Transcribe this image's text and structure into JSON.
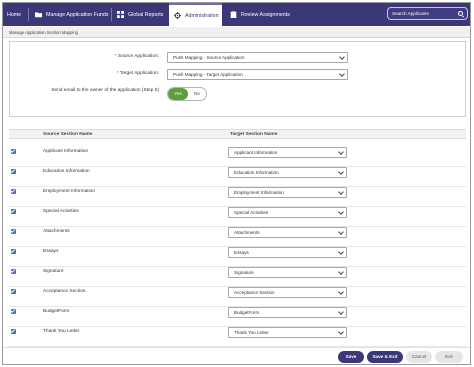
{
  "nav": {
    "home": "Home",
    "items": [
      {
        "label": "Manage Application Funds",
        "icon": "folder-icon"
      },
      {
        "label": "Global Reports",
        "icon": "grid-icon"
      },
      {
        "label": "Administration",
        "icon": "gear-icon"
      },
      {
        "label": "Review Assignments",
        "icon": "clipboard-icon"
      }
    ],
    "active": "Administration",
    "search_placeholder": "Search Applicants"
  },
  "breadcrumb": "Manage Application Section Mapping",
  "form": {
    "source_label": "Source Application:",
    "source_value": "Push Mapping - Source Application",
    "target_label": "Target Application:",
    "target_value": "Push Mapping - Target Application",
    "email_label": "Send email to the owner of the application (Step 5)",
    "toggle_yes": "Yes",
    "toggle_no": "No"
  },
  "table": {
    "col_source": "Source Section Name",
    "col_target": "Target Section Name",
    "rows": [
      {
        "source": "Applicant Information",
        "target": "Applicant Information",
        "checked": true
      },
      {
        "source": "Education Information",
        "target": "Education Information",
        "checked": true
      },
      {
        "source": "Employment Information",
        "target": "Employment Information",
        "checked": true
      },
      {
        "source": "Special Activities",
        "target": "Special Activities",
        "checked": true
      },
      {
        "source": "Attachments",
        "target": "Attachments",
        "checked": true
      },
      {
        "source": "Essays",
        "target": "Essays",
        "checked": true
      },
      {
        "source": "Signature",
        "target": "Signature",
        "checked": true
      },
      {
        "source": "Acceptance Section",
        "target": "Acceptance Section",
        "checked": true
      },
      {
        "source": "BudgetForm",
        "target": "BudgetForm",
        "checked": true
      },
      {
        "source": "Thank You Letter",
        "target": "Thank You Letter",
        "checked": true
      }
    ]
  },
  "footer": {
    "save": "Save",
    "save_exit": "Save & Exit",
    "cancel": "Cancel",
    "exit": "Exit"
  },
  "colors": {
    "nav_bg": "#3b3878",
    "toggle_on": "#5a9e3e",
    "checkbox": "#3f6fc4"
  }
}
